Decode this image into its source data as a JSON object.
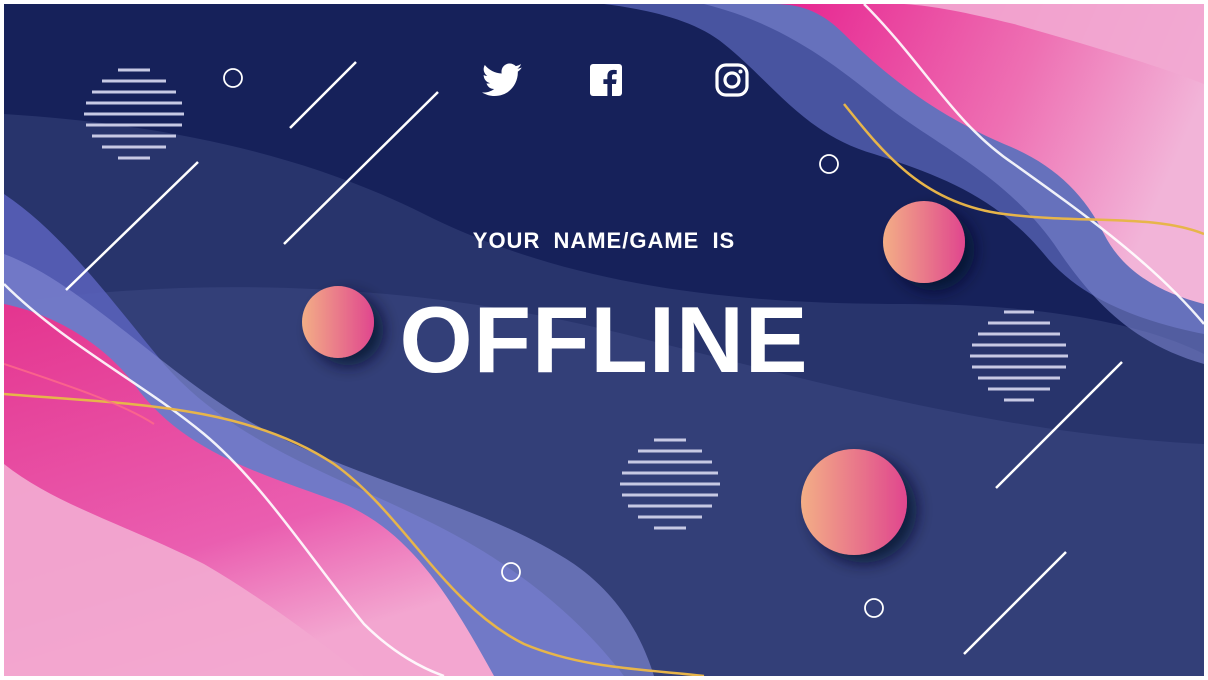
{
  "banner": {
    "subtitle": "YOUR NAME/GAME IS",
    "title": "OFFLINE"
  },
  "social": [
    {
      "icon": "twitter-icon"
    },
    {
      "icon": "facebook-icon"
    },
    {
      "icon": "instagram-icon"
    }
  ],
  "colors": {
    "background": "#16215a",
    "pink": "#e8259a",
    "light_pink": "#f3a3cf",
    "periwinkle": "#6b74c6",
    "orb_start": "#f3a98a",
    "orb_end": "#e2438d",
    "gold_line": "#e7b54a",
    "text": "#ffffff"
  }
}
